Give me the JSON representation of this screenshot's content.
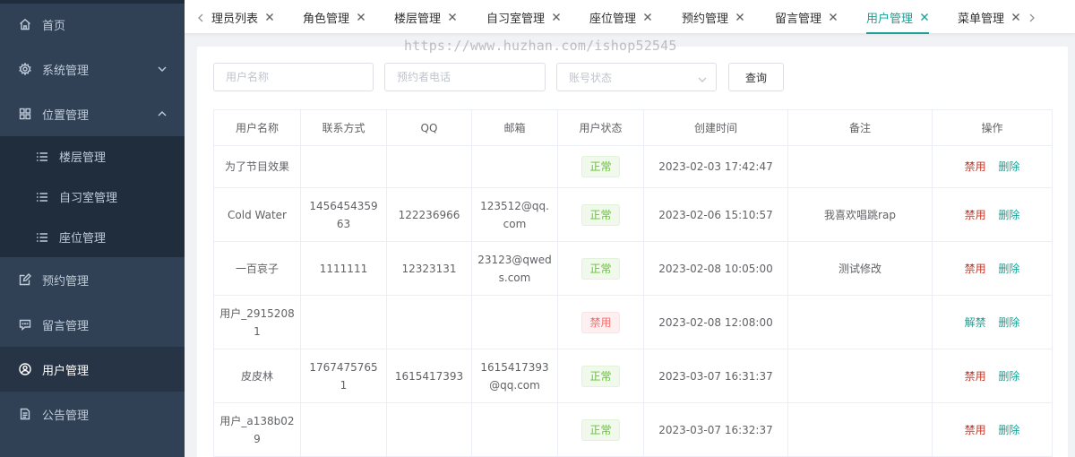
{
  "sidebar": {
    "items": [
      {
        "label": "首页",
        "icon": "home-icon"
      },
      {
        "label": "系统管理",
        "icon": "gear-icon",
        "expanded": false
      },
      {
        "label": "位置管理",
        "icon": "grid-icon",
        "expanded": true
      },
      {
        "label": "预约管理",
        "icon": "edit-icon"
      },
      {
        "label": "留言管理",
        "icon": "message-icon"
      },
      {
        "label": "用户管理",
        "icon": "user-icon",
        "active": true
      },
      {
        "label": "公告管理",
        "icon": "document-icon"
      }
    ],
    "submenu": [
      {
        "label": "楼层管理",
        "icon": "list-icon"
      },
      {
        "label": "自习室管理",
        "icon": "list-icon"
      },
      {
        "label": "座位管理",
        "icon": "list-icon"
      }
    ]
  },
  "tabs": [
    {
      "label": "理员列表"
    },
    {
      "label": "角色管理"
    },
    {
      "label": "楼层管理"
    },
    {
      "label": "自习室管理"
    },
    {
      "label": "座位管理"
    },
    {
      "label": "预约管理"
    },
    {
      "label": "留言管理"
    },
    {
      "label": "用户管理",
      "active": true
    },
    {
      "label": "菜单管理"
    }
  ],
  "watermark": "https://www.huzhan.com/ishop52545",
  "search": {
    "username_placeholder": "用户名称",
    "phone_placeholder": "预约者电话",
    "status_placeholder": "账号状态",
    "query_label": "查询"
  },
  "table": {
    "headers": [
      "用户名称",
      "联系方式",
      "QQ",
      "邮箱",
      "用户状态",
      "创建时间",
      "备注",
      "操作"
    ],
    "rows": [
      {
        "name": "为了节目效果",
        "phone": "",
        "qq": "",
        "email": "",
        "status": "正常",
        "created": "2023-02-03 17:42:47",
        "remark": "",
        "action1": "禁用",
        "action2": "删除"
      },
      {
        "name": "Cold Water",
        "phone": "145645435963",
        "qq": "122236966",
        "email": "123512@qq.com",
        "status": "正常",
        "created": "2023-02-06 15:10:57",
        "remark": "我喜欢唱跳rap",
        "action1": "禁用",
        "action2": "删除"
      },
      {
        "name": "一百哀子",
        "phone": "1111111",
        "qq": "12323131",
        "email": "23123@qweds.com",
        "status": "正常",
        "created": "2023-02-08 10:05:00",
        "remark": "测试修改",
        "action1": "禁用",
        "action2": "删除"
      },
      {
        "name": "用户_29152081",
        "phone": "",
        "qq": "",
        "email": "",
        "status": "禁用",
        "created": "2023-02-08 12:08:00",
        "remark": "",
        "action1": "解禁",
        "action2": "删除"
      },
      {
        "name": "皮皮林",
        "phone": "17674757651",
        "qq": "1615417393",
        "email": "1615417393@qq.com",
        "status": "正常",
        "created": "2023-03-07 16:31:37",
        "remark": "",
        "action1": "禁用",
        "action2": "删除"
      },
      {
        "name": "用户_a138b029",
        "phone": "",
        "qq": "",
        "email": "",
        "status": "正常",
        "created": "2023-03-07 16:32:37",
        "remark": "",
        "action1": "禁用",
        "action2": "删除"
      }
    ]
  },
  "colors": {
    "sidebar_bg": "#304156",
    "submenu_bg": "#1f2d3d",
    "accent": "#1aa094",
    "status_ok": "#67c23a",
    "status_ban": "#f56c6c",
    "action_danger": "#c0392b"
  }
}
